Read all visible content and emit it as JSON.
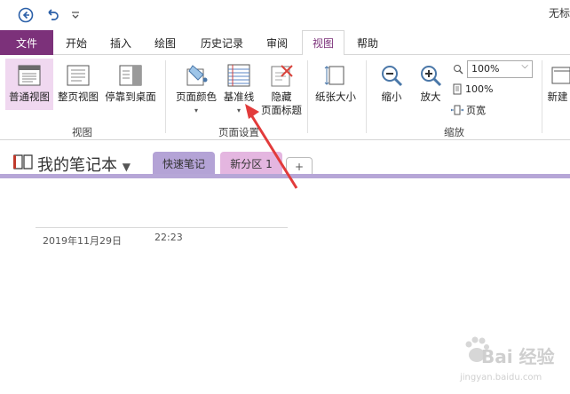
{
  "titlebar": {
    "title": "无标"
  },
  "menu": {
    "file": "文件",
    "tabs": [
      {
        "label": "开始"
      },
      {
        "label": "插入"
      },
      {
        "label": "绘图"
      },
      {
        "label": "历史记录"
      },
      {
        "label": "审阅"
      },
      {
        "label": "视图"
      },
      {
        "label": "帮助"
      }
    ]
  },
  "ribbon": {
    "view_group": {
      "normal": "普通视图",
      "fullpage": "整页视图",
      "dock": "停靠到桌面",
      "label": "视图"
    },
    "page_setup_group": {
      "page_color": "页面颜色",
      "rule_lines": "基准线",
      "hide_title_1": "隐藏",
      "hide_title_2": "页面标题",
      "paper_size": "纸张大小",
      "label": "页面设置"
    },
    "zoom_group": {
      "zoom_out": "缩小",
      "zoom_in": "放大",
      "zoom_value": "100%",
      "pct100": "100%",
      "page_width": "页宽",
      "label": "缩放"
    },
    "new_group": {
      "new": "新建"
    }
  },
  "notebook": {
    "title": "我的笔记本",
    "sections": [
      {
        "label": "快速笔记",
        "color": "#b4a3d6"
      },
      {
        "label": "新分区 1",
        "color": "#e4b6e0"
      }
    ],
    "add_label": "+"
  },
  "page": {
    "date": "2019年11月29日",
    "time": "22:23"
  },
  "watermark": {
    "text": "Bai 经验",
    "sub": "jingyan.baidu.com"
  }
}
